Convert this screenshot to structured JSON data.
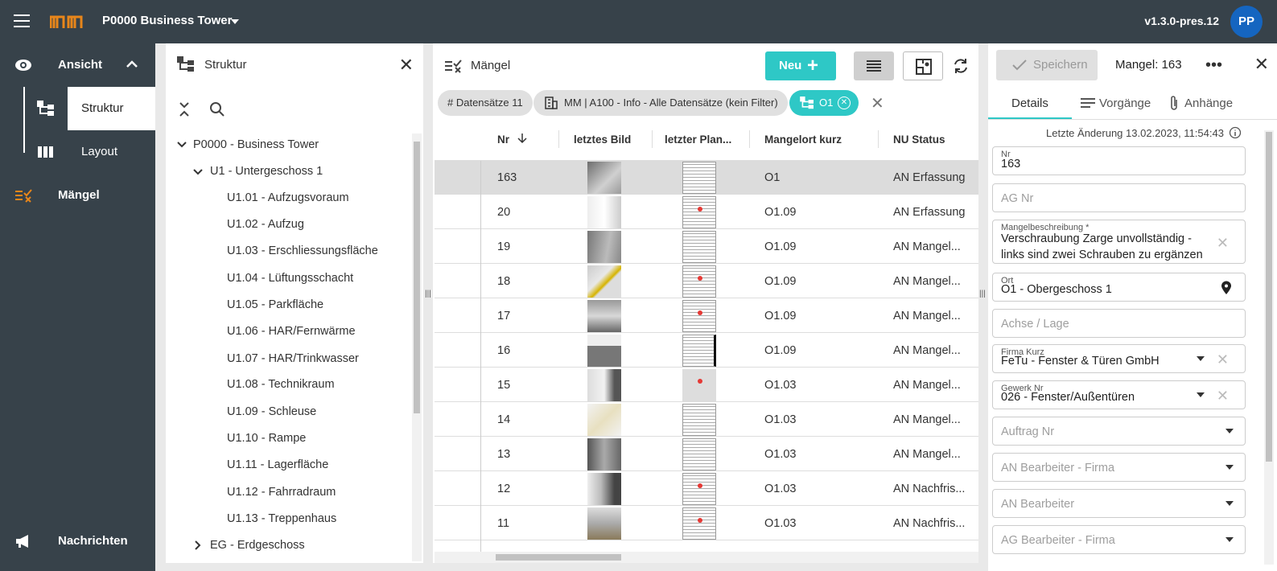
{
  "topbar": {
    "app_logo": "mm-logo",
    "project": "P0000 Business Tower",
    "version": "v1.3.0-pres.12",
    "avatar_initials": "PP"
  },
  "leftnav": {
    "ansicht": "Ansicht",
    "struktur": "Struktur",
    "layout": "Layout",
    "maengel": "Mängel",
    "nachrichten": "Nachrichten"
  },
  "structure": {
    "title": "Struktur",
    "root": "P0000 - Business Tower",
    "level1": "U1 - Untergeschoss 1",
    "items": [
      "U1.01 - Aufzugsvoraum",
      "U1.02 - Aufzug",
      "U1.03 - Erschliessungsfläche",
      "U1.04 - Lüftungsschacht",
      "U1.05 - Parkfläche",
      "U1.06 - HAR/Fernwärme",
      "U1.07 - HAR/Trinkwasser",
      "U1.08 - Technikraum",
      "U1.09 - Schleuse",
      "U1.10 - Rampe",
      "U1.11 - Lagerfläche",
      "U1.12 - Fahrradraum",
      "U1.13 - Treppenhaus"
    ],
    "next_level": "EG - Erdgeschoss"
  },
  "maengel": {
    "title": "Mängel",
    "new_button": "Neu",
    "chips": {
      "count": "# Datensätze 11",
      "filter": "MM | A100 - Info - Alle Datensätze (kein Filter)",
      "location": "O1"
    },
    "columns": [
      "Nr",
      "letztes Bild",
      "letzter Plan...",
      "Mangelort kurz",
      "NU Status"
    ],
    "rows": [
      {
        "nr": "163",
        "ort": "O1",
        "status": "AN Erfassung"
      },
      {
        "nr": "20",
        "ort": "O1.09",
        "status": "AN Erfassung"
      },
      {
        "nr": "19",
        "ort": "O1.09",
        "status": "AN Mangel..."
      },
      {
        "nr": "18",
        "ort": "O1.09",
        "status": "AN Mangel..."
      },
      {
        "nr": "17",
        "ort": "O1.09",
        "status": "AN Mangel..."
      },
      {
        "nr": "16",
        "ort": "O1.09",
        "status": "AN Mangel..."
      },
      {
        "nr": "15",
        "ort": "O1.03",
        "status": "AN Mangel..."
      },
      {
        "nr": "14",
        "ort": "O1.03",
        "status": "AN Mangel..."
      },
      {
        "nr": "13",
        "ort": "O1.03",
        "status": "AN Mangel..."
      },
      {
        "nr": "12",
        "ort": "O1.03",
        "status": "AN Nachfris..."
      },
      {
        "nr": "11",
        "ort": "O1.03",
        "status": "AN Nachfris..."
      }
    ]
  },
  "detail": {
    "save": "Speichern",
    "title": "Mangel: 163",
    "tabs": [
      "Details",
      "Vorgänge",
      "Anhänge"
    ],
    "last_change": "Letzte Änderung 13.02.2023, 11:54:43",
    "fields": {
      "nr_label": "Nr",
      "nr_value": "163",
      "ag_nr": "AG Nr",
      "beschreibung_label": "Mangelbeschreibung *",
      "beschreibung_line1": "Verschraubung Zarge unvollständig -",
      "beschreibung_line2": "links sind zwei Schrauben zu ergänzen",
      "ort_label": "Ort",
      "ort_value": "O1  - Obergeschoss 1",
      "achse": "Achse / Lage",
      "firma_label": "Firma Kurz",
      "firma_value": "FeTu - Fenster & Türen GmbH",
      "gewerk_label": "Gewerk Nr",
      "gewerk_value": "026 - Fenster/Außentüren",
      "auftrag": "Auftrag Nr",
      "an_firma": "AN Bearbeiter - Firma",
      "an_bearbeiter": "AN Bearbeiter",
      "ag_firma": "AG Bearbeiter - Firma"
    }
  },
  "colors": {
    "dark": "#37424a",
    "accent": "#2ec8c6",
    "logo": "#e8861a",
    "avatar": "#1565c0"
  }
}
